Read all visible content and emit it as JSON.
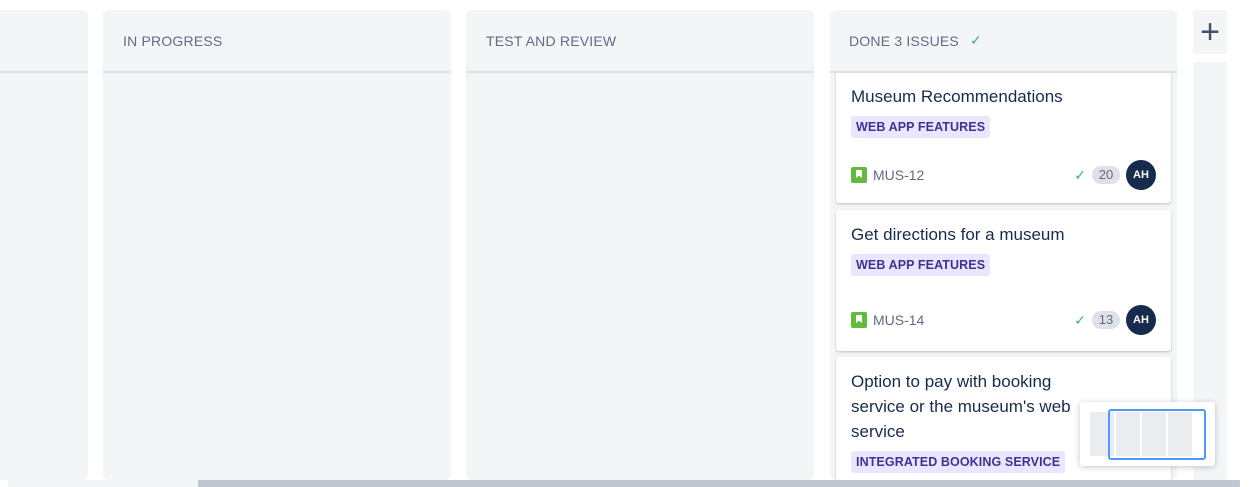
{
  "columns": [
    {
      "title": "",
      "cards": []
    },
    {
      "title": "IN PROGRESS",
      "cards": []
    },
    {
      "title": "TEST AND REVIEW",
      "cards": []
    },
    {
      "title": "DONE 3 ISSUES",
      "check_icon": "check-icon",
      "cards": [
        {
          "title": "Museum Recommendations",
          "epic": "WEB APP FEATURES",
          "issue_type_icon": "story-icon",
          "key": "MUS-12",
          "resolved_icon": "check-icon",
          "points": "20",
          "assignee_initials": "AH"
        },
        {
          "title": "Get directions for a museum",
          "epic": "WEB APP FEATURES",
          "issue_type_icon": "story-icon",
          "key": "MUS-14",
          "resolved_icon": "check-icon",
          "points": "13",
          "assignee_initials": "AH"
        },
        {
          "title": "Option to pay with booking service or the museum's web service",
          "epic": "INTEGRATED BOOKING SERVICE"
        }
      ]
    }
  ],
  "add_column": {
    "icon": "plus-icon"
  },
  "colors": {
    "column_bg": "#f4f5f7",
    "epic_bg": "#eae6ff",
    "epic_text": "#403294",
    "story_green": "#63ba3c",
    "check_green": "#36b37e",
    "avatar_bg": "#172b4d",
    "minimap_border": "#4c9aff"
  }
}
